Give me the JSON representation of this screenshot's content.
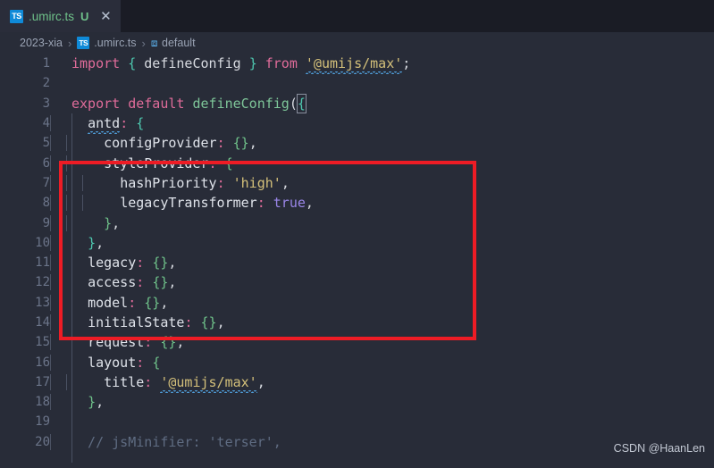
{
  "window": {
    "theme_background": "#282c38",
    "tabbar_background": "#1a1c25",
    "active_tab_background": "#2a2d3a"
  },
  "tabbar": {
    "tabs": [
      {
        "icon": "typescript-file-icon",
        "icon_label": "TS",
        "label": ".umirc.ts",
        "badge": "U",
        "close": "✕",
        "active": true
      }
    ]
  },
  "breadcrumb": {
    "segments": [
      {
        "label": "2023-xia",
        "icon": null
      },
      {
        "label": ".umirc.ts",
        "icon": "TS"
      },
      {
        "label": "default",
        "icon": "⧈"
      }
    ],
    "separator": "›"
  },
  "editor": {
    "language": "typescript",
    "first_line": 1,
    "lines": [
      {
        "n": "1",
        "tokens": [
          {
            "t": "import",
            "c": "t-kw"
          },
          {
            "t": " ",
            "c": "t-plain"
          },
          {
            "t": "{",
            "c": "t-brace"
          },
          {
            "t": " ",
            "c": "t-plain"
          },
          {
            "t": "defineConfig",
            "c": "t-plain"
          },
          {
            "t": " ",
            "c": "t-plain"
          },
          {
            "t": "}",
            "c": "t-brace"
          },
          {
            "t": " ",
            "c": "t-plain"
          },
          {
            "t": "from",
            "c": "t-kw"
          },
          {
            "t": " ",
            "c": "t-plain"
          },
          {
            "t": "'@umijs/max'",
            "c": "t-str",
            "squiggle": true
          },
          {
            "t": ";",
            "c": "t-plain"
          }
        ]
      },
      {
        "n": "2",
        "tokens": []
      },
      {
        "n": "3",
        "tokens": [
          {
            "t": "export",
            "c": "t-kw"
          },
          {
            "t": " ",
            "c": "t-plain"
          },
          {
            "t": "default",
            "c": "t-kw"
          },
          {
            "t": " ",
            "c": "t-plain"
          },
          {
            "t": "defineConfig",
            "c": "t-fn"
          },
          {
            "t": "(",
            "c": "t-paren"
          },
          {
            "t": "{",
            "c": "t-brace",
            "match": true
          }
        ]
      },
      {
        "n": "4",
        "indent": 1,
        "tokens": [
          {
            "t": "  ",
            "c": "t-plain"
          },
          {
            "t": "antd",
            "c": "t-prop",
            "squiggle": true
          },
          {
            "t": ":",
            "c": "t-punct"
          },
          {
            "t": " ",
            "c": "t-plain"
          },
          {
            "t": "{",
            "c": "t-brace"
          }
        ]
      },
      {
        "n": "5",
        "indent": 2,
        "tokens": [
          {
            "t": "    ",
            "c": "t-plain"
          },
          {
            "t": "configProvider",
            "c": "t-prop"
          },
          {
            "t": ":",
            "c": "t-punct"
          },
          {
            "t": " ",
            "c": "t-plain"
          },
          {
            "t": "{}",
            "c": "t-brace2"
          },
          {
            "t": ",",
            "c": "t-plain"
          }
        ]
      },
      {
        "n": "6",
        "indent": 2,
        "tokens": [
          {
            "t": "    ",
            "c": "t-plain"
          },
          {
            "t": "styleProvider",
            "c": "t-prop"
          },
          {
            "t": ":",
            "c": "t-punct"
          },
          {
            "t": " ",
            "c": "t-plain"
          },
          {
            "t": "{",
            "c": "t-brace2"
          }
        ]
      },
      {
        "n": "7",
        "indent": 3,
        "tokens": [
          {
            "t": "      ",
            "c": "t-plain"
          },
          {
            "t": "hashPriority",
            "c": "t-prop"
          },
          {
            "t": ":",
            "c": "t-punct"
          },
          {
            "t": " ",
            "c": "t-plain"
          },
          {
            "t": "'high'",
            "c": "t-str"
          },
          {
            "t": ",",
            "c": "t-plain"
          }
        ]
      },
      {
        "n": "8",
        "indent": 3,
        "tokens": [
          {
            "t": "      ",
            "c": "t-plain"
          },
          {
            "t": "legacyTransformer",
            "c": "t-prop"
          },
          {
            "t": ":",
            "c": "t-punct"
          },
          {
            "t": " ",
            "c": "t-plain"
          },
          {
            "t": "true",
            "c": "t-bool"
          },
          {
            "t": ",",
            "c": "t-plain"
          }
        ]
      },
      {
        "n": "9",
        "indent": 2,
        "tokens": [
          {
            "t": "    ",
            "c": "t-plain"
          },
          {
            "t": "}",
            "c": "t-brace2"
          },
          {
            "t": ",",
            "c": "t-plain"
          }
        ]
      },
      {
        "n": "10",
        "indent": 1,
        "tokens": [
          {
            "t": "  ",
            "c": "t-plain"
          },
          {
            "t": "}",
            "c": "t-brace"
          },
          {
            "t": ",",
            "c": "t-plain"
          }
        ]
      },
      {
        "n": "11",
        "indent": 1,
        "tokens": [
          {
            "t": "  ",
            "c": "t-plain"
          },
          {
            "t": "legacy",
            "c": "t-prop"
          },
          {
            "t": ":",
            "c": "t-punct"
          },
          {
            "t": " ",
            "c": "t-plain"
          },
          {
            "t": "{}",
            "c": "t-brace2"
          },
          {
            "t": ",",
            "c": "t-plain"
          }
        ]
      },
      {
        "n": "12",
        "indent": 1,
        "tokens": [
          {
            "t": "  ",
            "c": "t-plain"
          },
          {
            "t": "access",
            "c": "t-prop"
          },
          {
            "t": ":",
            "c": "t-punct"
          },
          {
            "t": " ",
            "c": "t-plain"
          },
          {
            "t": "{}",
            "c": "t-brace2"
          },
          {
            "t": ",",
            "c": "t-plain"
          }
        ]
      },
      {
        "n": "13",
        "indent": 1,
        "tokens": [
          {
            "t": "  ",
            "c": "t-plain"
          },
          {
            "t": "model",
            "c": "t-prop"
          },
          {
            "t": ":",
            "c": "t-punct"
          },
          {
            "t": " ",
            "c": "t-plain"
          },
          {
            "t": "{}",
            "c": "t-brace2"
          },
          {
            "t": ",",
            "c": "t-plain"
          }
        ]
      },
      {
        "n": "14",
        "indent": 1,
        "tokens": [
          {
            "t": "  ",
            "c": "t-plain"
          },
          {
            "t": "initialState",
            "c": "t-prop"
          },
          {
            "t": ":",
            "c": "t-punct"
          },
          {
            "t": " ",
            "c": "t-plain"
          },
          {
            "t": "{}",
            "c": "t-brace2"
          },
          {
            "t": ",",
            "c": "t-plain"
          }
        ]
      },
      {
        "n": "15",
        "indent": 1,
        "tokens": [
          {
            "t": "  ",
            "c": "t-plain"
          },
          {
            "t": "request",
            "c": "t-prop"
          },
          {
            "t": ":",
            "c": "t-punct"
          },
          {
            "t": " ",
            "c": "t-plain"
          },
          {
            "t": "{}",
            "c": "t-brace2"
          },
          {
            "t": ",",
            "c": "t-plain"
          }
        ]
      },
      {
        "n": "16",
        "indent": 1,
        "tokens": [
          {
            "t": "  ",
            "c": "t-plain"
          },
          {
            "t": "layout",
            "c": "t-prop"
          },
          {
            "t": ":",
            "c": "t-punct"
          },
          {
            "t": " ",
            "c": "t-plain"
          },
          {
            "t": "{",
            "c": "t-brace2"
          }
        ]
      },
      {
        "n": "17",
        "indent": 2,
        "tokens": [
          {
            "t": "    ",
            "c": "t-plain"
          },
          {
            "t": "title",
            "c": "t-prop"
          },
          {
            "t": ":",
            "c": "t-punct"
          },
          {
            "t": " ",
            "c": "t-plain"
          },
          {
            "t": "'@umijs/max'",
            "c": "t-str",
            "squiggle": true
          },
          {
            "t": ",",
            "c": "t-plain"
          }
        ]
      },
      {
        "n": "18",
        "indent": 1,
        "tokens": [
          {
            "t": "  ",
            "c": "t-plain"
          },
          {
            "t": "}",
            "c": "t-brace2"
          },
          {
            "t": ",",
            "c": "t-plain"
          }
        ]
      },
      {
        "n": "19",
        "tokens": []
      },
      {
        "n": "20",
        "indent": 1,
        "tokens": [
          {
            "t": "  // jsMinifier: 'terser',",
            "c": "t-comment"
          }
        ]
      }
    ]
  },
  "annotation": {
    "type": "rectangle-highlight",
    "color": "#ee1c25",
    "covers_lines": "4-11"
  },
  "watermark": {
    "text": "CSDN @HaanLen"
  }
}
